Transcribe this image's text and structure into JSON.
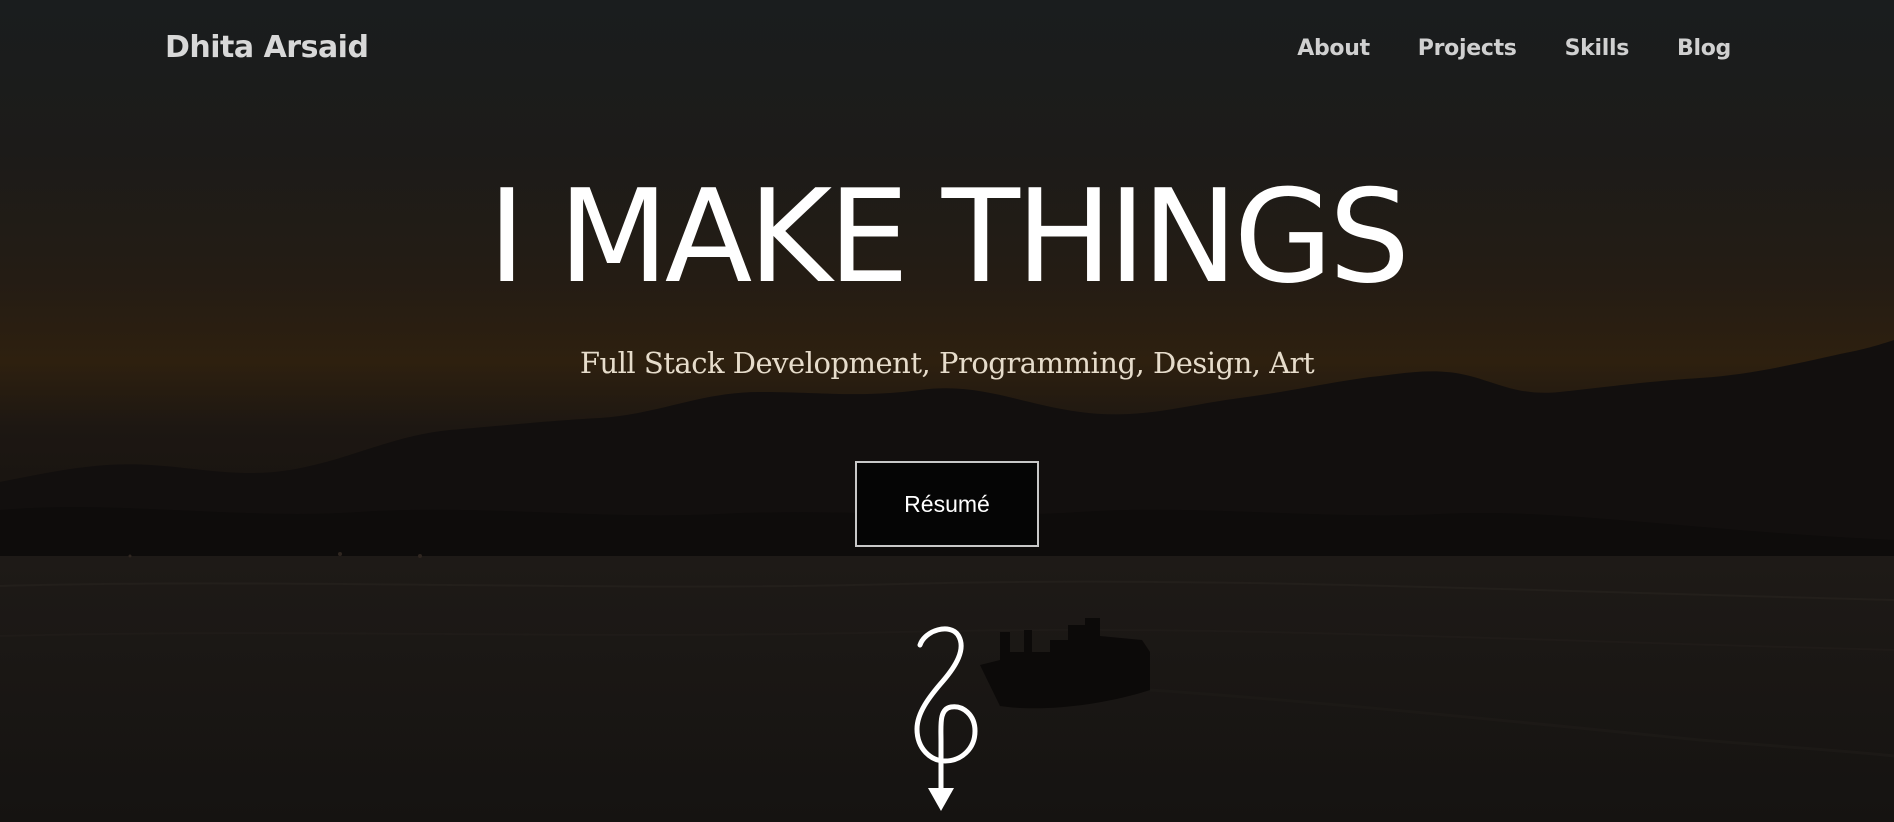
{
  "brand": {
    "name": "Dhita Arsaid"
  },
  "nav": {
    "items": [
      {
        "label": "About"
      },
      {
        "label": "Projects"
      },
      {
        "label": "Skills"
      },
      {
        "label": "Blog"
      }
    ]
  },
  "hero": {
    "headline": "I MAKE THINGS",
    "subtitle": "Full Stack Development, Programming, Design, Art",
    "resume_label": "Résumé",
    "scroll_icon": "scroll-down-arrow-icon",
    "background_image": "dusk-mountains-harbor-ship"
  },
  "colors": {
    "text": "#ffffff",
    "nav_text": "#d0d0d0",
    "subtitle_text": "#e6dccb",
    "button_border": "#c8c8c8",
    "button_bg": "#050505"
  }
}
